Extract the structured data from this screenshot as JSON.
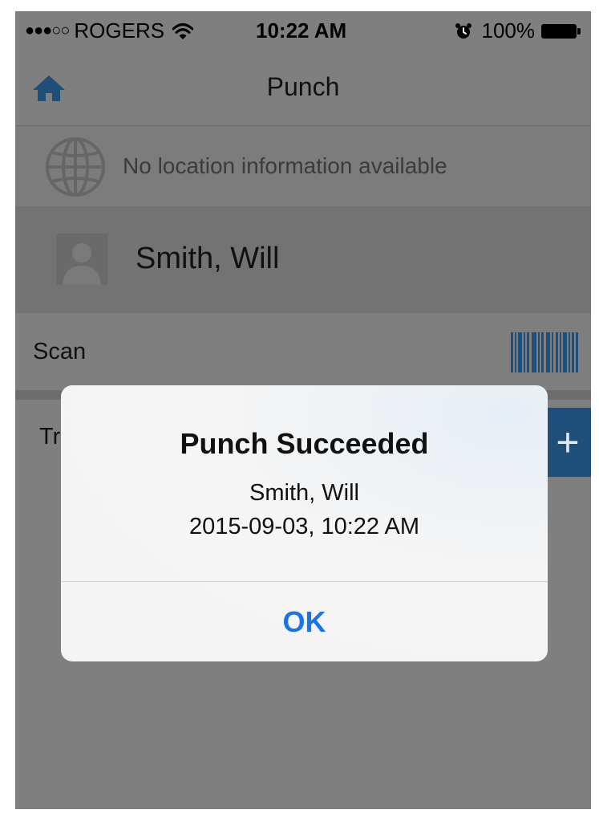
{
  "status_bar": {
    "signal": "●●●○○",
    "carrier": "ROGERS",
    "time": "10:22 AM",
    "battery_percent": "100%",
    "icons": [
      "wifi-icon",
      "alarm-icon",
      "battery-icon"
    ]
  },
  "nav": {
    "title": "Punch",
    "home_icon": "home-icon",
    "accent_color": "#1e4f7a"
  },
  "location": {
    "icon": "globe-icon",
    "text": "No location information available"
  },
  "user": {
    "avatar_icon": "user-silhouette-icon",
    "name": "Smith, Will"
  },
  "rows": {
    "scan_label": "Scan",
    "scan_icon": "barcode-icon",
    "transfer_label_visible": "Tr",
    "add_icon": "+"
  },
  "alert": {
    "title": "Punch Succeeded",
    "name": "Smith, Will",
    "datetime": "2015-09-03, 10:22 AM",
    "ok_label": "OK",
    "ok_color": "#1a74e8"
  }
}
